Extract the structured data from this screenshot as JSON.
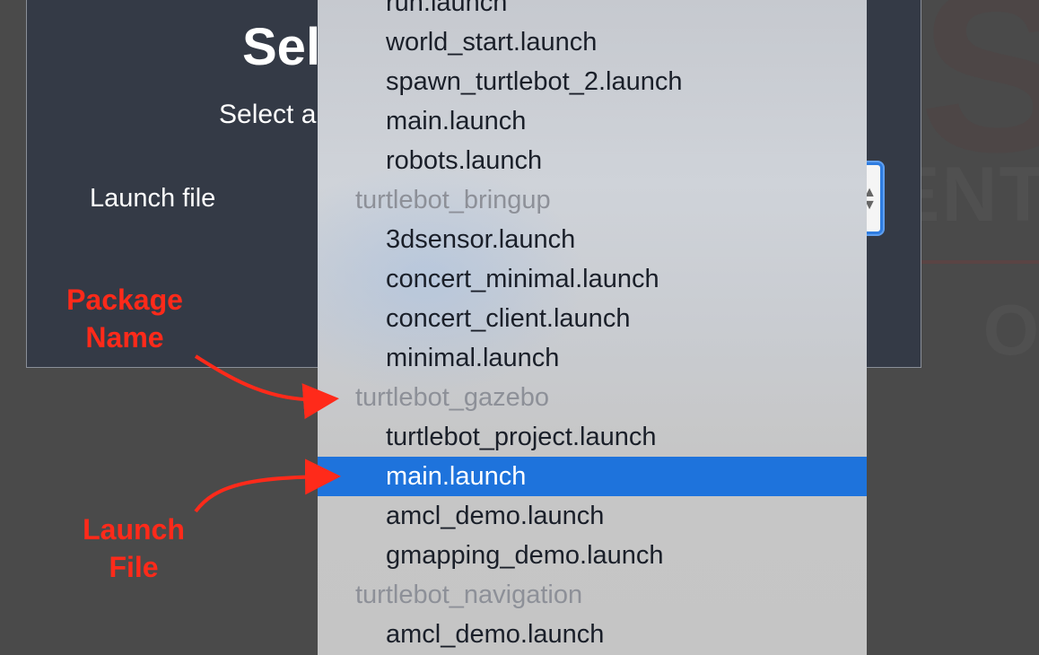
{
  "background": {
    "letters": [
      "S",
      "ENT",
      "O"
    ]
  },
  "modal": {
    "title": "Sel",
    "subtitle": "Select a",
    "field_label": "Launch file"
  },
  "dropdown": {
    "items": [
      {
        "label": "run.launch",
        "type": "option"
      },
      {
        "label": "world_start.launch",
        "type": "option"
      },
      {
        "label": "spawn_turtlebot_2.launch",
        "type": "option"
      },
      {
        "label": "main.launch",
        "type": "option"
      },
      {
        "label": "robots.launch",
        "type": "option"
      },
      {
        "label": "turtlebot_bringup",
        "type": "group"
      },
      {
        "label": "3dsensor.launch",
        "type": "option"
      },
      {
        "label": "concert_minimal.launch",
        "type": "option"
      },
      {
        "label": "concert_client.launch",
        "type": "option"
      },
      {
        "label": "minimal.launch",
        "type": "option"
      },
      {
        "label": "turtlebot_gazebo",
        "type": "group"
      },
      {
        "label": "turtlebot_project.launch",
        "type": "option"
      },
      {
        "label": "main.launch",
        "type": "option",
        "selected": true
      },
      {
        "label": "amcl_demo.launch",
        "type": "option"
      },
      {
        "label": "gmapping_demo.launch",
        "type": "option"
      },
      {
        "label": "turtlebot_navigation",
        "type": "group"
      },
      {
        "label": "amcl_demo.launch",
        "type": "option"
      }
    ]
  },
  "annotations": {
    "package_name": "Package\nName",
    "launch_file": "Launch\nFile",
    "color": "#ff2a1a"
  },
  "colors": {
    "selected_bg": "#1e73dc",
    "modal_bg": "#343a46",
    "group_text": "#8d9098"
  }
}
